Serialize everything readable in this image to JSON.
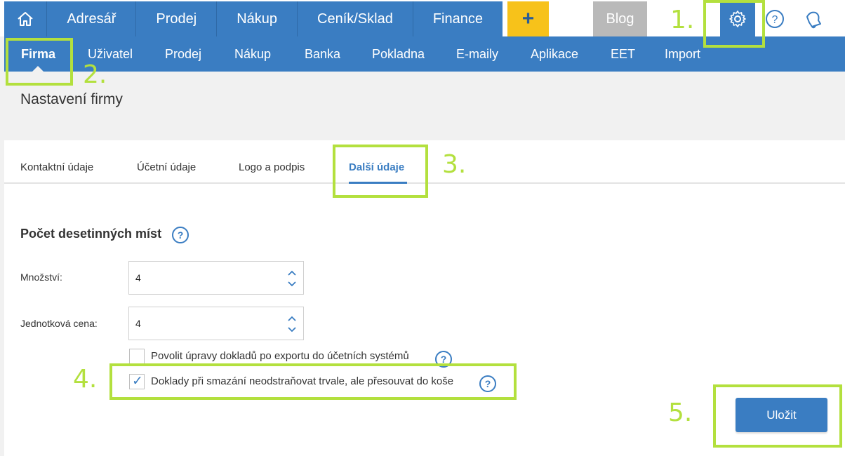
{
  "topnav": {
    "items": [
      "Adresář",
      "Prodej",
      "Nákup",
      "Ceník/Sklad",
      "Finance"
    ],
    "plus_label": "+",
    "blog_label": "Blog"
  },
  "subnav": {
    "items": [
      "Firma",
      "Uživatel",
      "Prodej",
      "Nákup",
      "Banka",
      "Pokladna",
      "E-maily",
      "Aplikace",
      "EET",
      "Import"
    ],
    "active_item": "Firma"
  },
  "page": {
    "title": "Nastavení firmy"
  },
  "tabs": [
    "Kontaktní údaje",
    "Účetní údaje",
    "Logo a podpis",
    "Další údaje"
  ],
  "active_tab": "Další údaje",
  "section": {
    "title": "Počet desetinných míst",
    "fields": [
      {
        "label": "Množství:",
        "value": "4"
      },
      {
        "label": "Jednotková cena:",
        "value": "4"
      }
    ],
    "checkboxes": [
      {
        "label": "Povolit úpravy dokladů po exportu do účetních systémů",
        "checked": false
      },
      {
        "label": "Doklady při smazání neodstraňovat trvale, ale přesouvat do koše",
        "checked": true
      }
    ]
  },
  "save_label": "Uložit",
  "annotations": [
    "1.",
    "2.",
    "3.",
    "4.",
    "5."
  ],
  "colors": {
    "accent": "#3a7dc2",
    "highlight": "#b3e03e",
    "plus_button": "#f7c21a",
    "blog_button": "#b9b9b9"
  }
}
